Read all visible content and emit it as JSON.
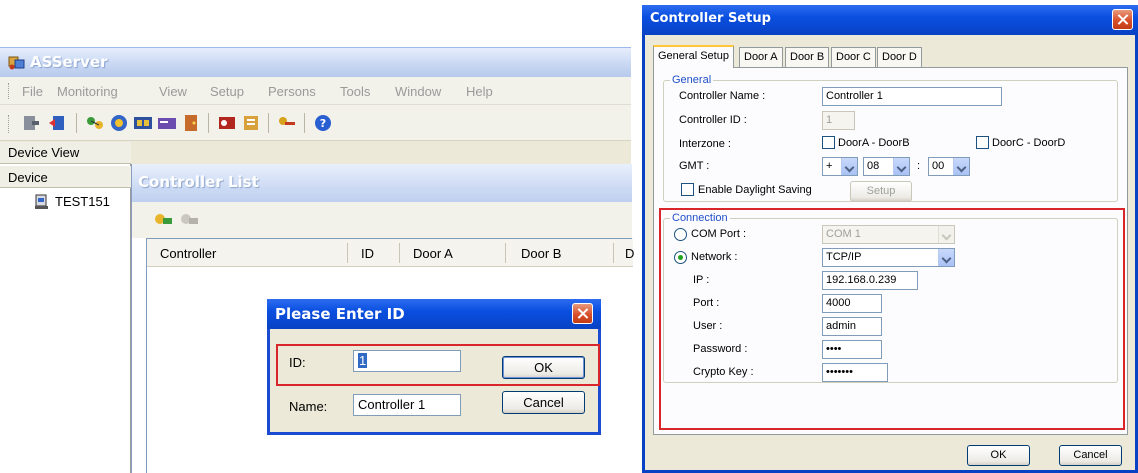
{
  "asserver": {
    "title": "ASServer",
    "menu": [
      "File",
      "Monitoring",
      "View",
      "Setup",
      "Persons",
      "Tools",
      "Window",
      "Help"
    ],
    "toolbar_icons": [
      "exit-icon",
      "logout-icon",
      "connect-icon",
      "monitoring-icon",
      "controller-icon",
      "card-icon",
      "door-icon",
      "person-icon",
      "report-icon",
      "key-icon",
      "help-icon"
    ],
    "device_view": {
      "title": "Device View",
      "column": "Device",
      "items": [
        "TEST151"
      ]
    },
    "controller_list": {
      "title": "Controller List",
      "toolbar_icons": [
        "add-controller-icon",
        "remove-controller-icon"
      ],
      "columns": [
        "Controller",
        "ID",
        "Door A",
        "Door B",
        "D"
      ]
    },
    "enter_id_dialog": {
      "title": "Please Enter ID",
      "id_label": "ID:",
      "id_value": "1",
      "name_label": "Name:",
      "name_value": "Controller 1",
      "ok_label": "OK",
      "cancel_label": "Cancel"
    }
  },
  "setup": {
    "title": "Controller Setup",
    "tabs": [
      "General Setup",
      "Door A",
      "Door B",
      "Door C",
      "Door D"
    ],
    "active_tab": "General Setup",
    "general": {
      "group_title": "General",
      "controller_name_label": "Controller Name :",
      "controller_name_value": "Controller 1",
      "controller_id_label": "Controller ID :",
      "controller_id_value": "1",
      "interzone_label": "Interzone :",
      "interzone_ab_label": "DoorA - DoorB",
      "interzone_cd_label": "DoorC - DoorD",
      "gmt_label": "GMT :",
      "gmt_sign": "+",
      "gmt_hours": "08",
      "gmt_colon": ":",
      "gmt_minutes": "00",
      "daylight_label": "Enable Daylight Saving",
      "setup_button": "Setup"
    },
    "connection": {
      "group_title": "Connection",
      "com_port_label": "COM Port :",
      "com_port_value": "COM 1",
      "network_label": "Network :",
      "network_value": "TCP/IP",
      "selected": "Network",
      "ip_label": "IP :",
      "ip_value": "192.168.0.239",
      "port_label": "Port :",
      "port_value": "4000",
      "user_label": "User :",
      "user_value": "admin",
      "password_label": "Password :",
      "password_value": "••••",
      "crypto_label": "Crypto Key :",
      "crypto_value": "•••••••"
    },
    "ok_label": "OK",
    "cancel_label": "Cancel"
  },
  "colors": {
    "highlight": "#d8262a",
    "xp_title_blue": "#0a4fe0",
    "inactive_title": "#c9d8f3",
    "group_label": "#1f4fc9"
  }
}
